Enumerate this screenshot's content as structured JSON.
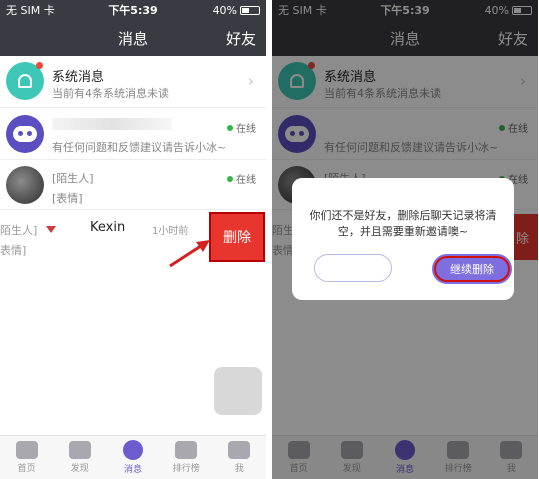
{
  "status": {
    "carrier": "无 SIM 卡",
    "time": "下午5:39",
    "battery": "40%"
  },
  "nav": {
    "title": "消息",
    "friends": "好友"
  },
  "messages": [
    {
      "name": "系统消息",
      "preview": "当前有4条系统消息未读"
    },
    {
      "name": "",
      "status": "在线",
      "preview": "有任何问题和反馈建议请告诉小冰~"
    },
    {
      "name": "[陌生人]",
      "status": "在线",
      "preview": "[表情]"
    }
  ],
  "kexin_row": {
    "stranger": "陌生人]",
    "name": "Kexin",
    "time": "1小时前",
    "preview": "表情]"
  },
  "delete_label": "删除",
  "dialog": {
    "message": "你们还不是好友，删除后聊天记录将清空，并且需要重新邀请噢~",
    "confirm": "继续删除"
  },
  "tabs": [
    "首页",
    "发现",
    "消息",
    "排行榜",
    "我"
  ],
  "right_labels": {
    "system": "系统消息",
    "system_sub": "当前有4条系统消息未读",
    "preview": "有任何问题和反馈建议请告诉小冰~",
    "online": "在线",
    "stranger": "[陌生人]",
    "stranger2": "陌生人]",
    "expr": "表情]",
    "peek": "除"
  },
  "colors": {
    "accent": "#6d5bd0",
    "delete": "#e8362f",
    "online": "#3cb34a",
    "navbar": "#3a3a42"
  }
}
